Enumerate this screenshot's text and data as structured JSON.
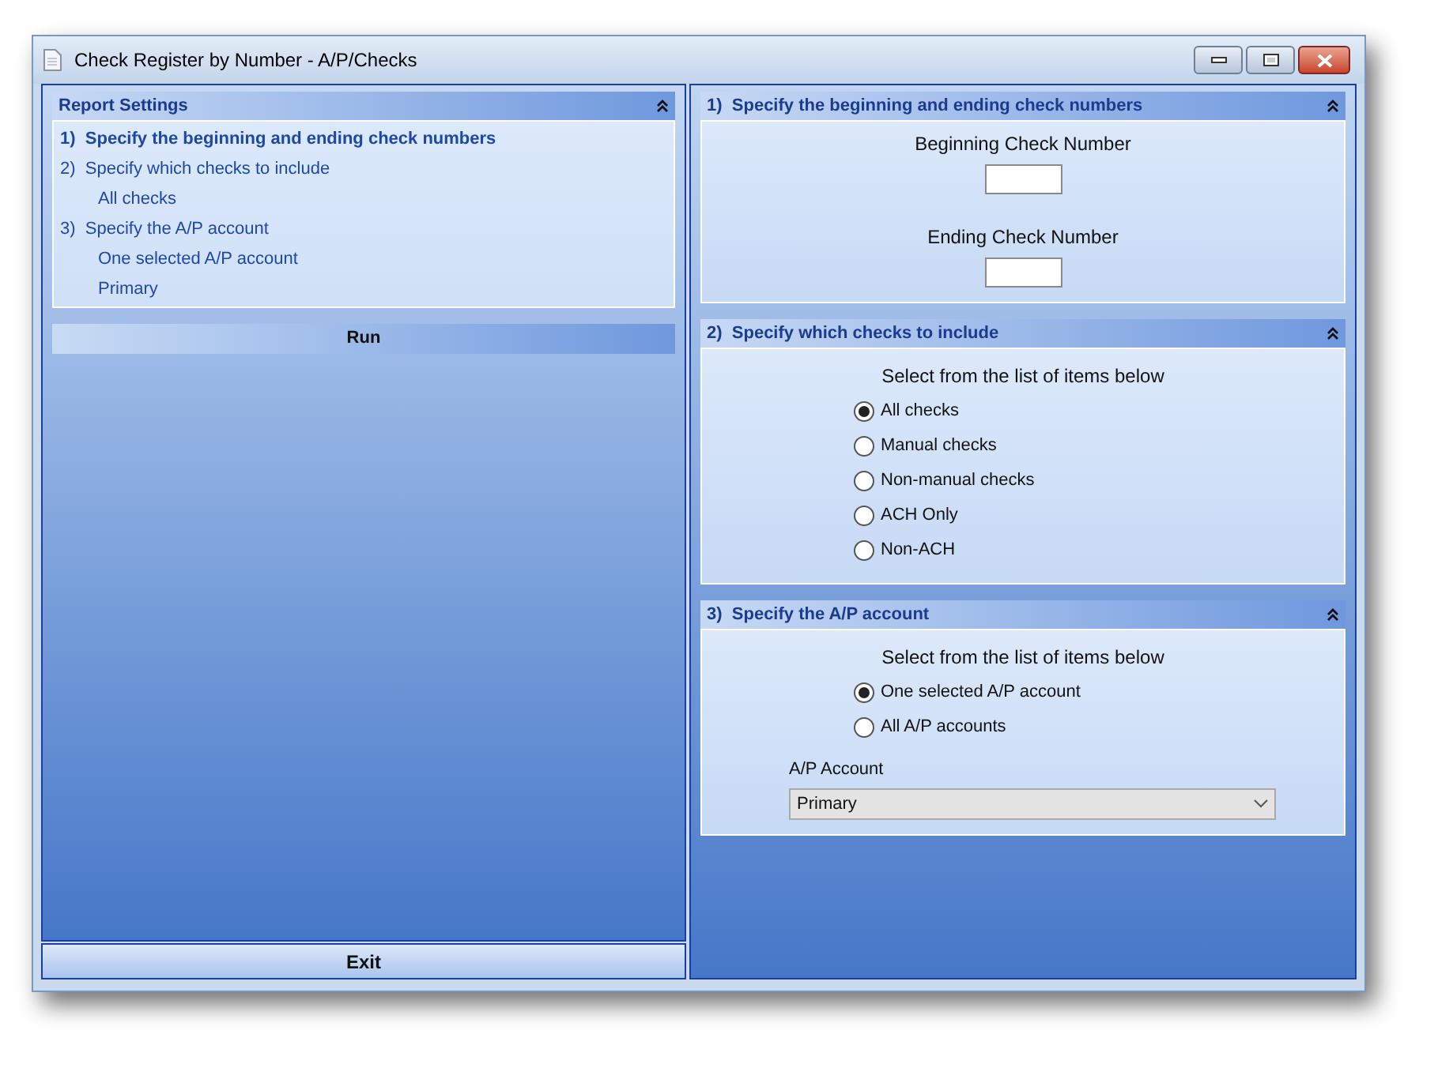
{
  "window": {
    "title": "Check Register by Number - A/P/Checks"
  },
  "report_settings": {
    "title": "Report Settings",
    "expanded": true,
    "items": [
      {
        "text": "1)  Specify the beginning and ending check numbers",
        "selected": true
      },
      {
        "text": "2)  Specify which checks to include",
        "selected": false,
        "children": [
          {
            "text": "All checks"
          }
        ]
      },
      {
        "text": "3)  Specify the A/P account",
        "selected": false,
        "children": [
          {
            "text": "One selected A/P account"
          },
          {
            "text": "Primary"
          }
        ]
      }
    ]
  },
  "run_button": "Run",
  "exit_button": "Exit",
  "sections": [
    {
      "kind": "number_range",
      "title": "1)  Specify the beginning and ending check numbers",
      "expanded": true,
      "fields": [
        {
          "label": "Beginning Check Number"
        },
        {
          "label": "Ending Check Number"
        }
      ]
    },
    {
      "kind": "radio_list",
      "title": "2)  Specify which checks to include",
      "expanded": true,
      "prompt": "Select from the list of items below",
      "options": [
        {
          "label": "All checks",
          "selected": true
        },
        {
          "label": "Manual checks",
          "selected": false
        },
        {
          "label": "Non-manual checks",
          "selected": false
        },
        {
          "label": "ACH Only",
          "selected": false
        },
        {
          "label": "Non-ACH",
          "selected": false
        }
      ]
    },
    {
      "kind": "radio_list",
      "title": "3)  Specify the A/P account",
      "expanded": true,
      "prompt": "Select from the list of items below",
      "options": [
        {
          "label": "One selected A/P account",
          "selected": true
        },
        {
          "label": "All A/P accounts",
          "selected": false
        }
      ],
      "dropdown": {
        "label": "A/P Account",
        "value": "Primary"
      }
    }
  ]
}
